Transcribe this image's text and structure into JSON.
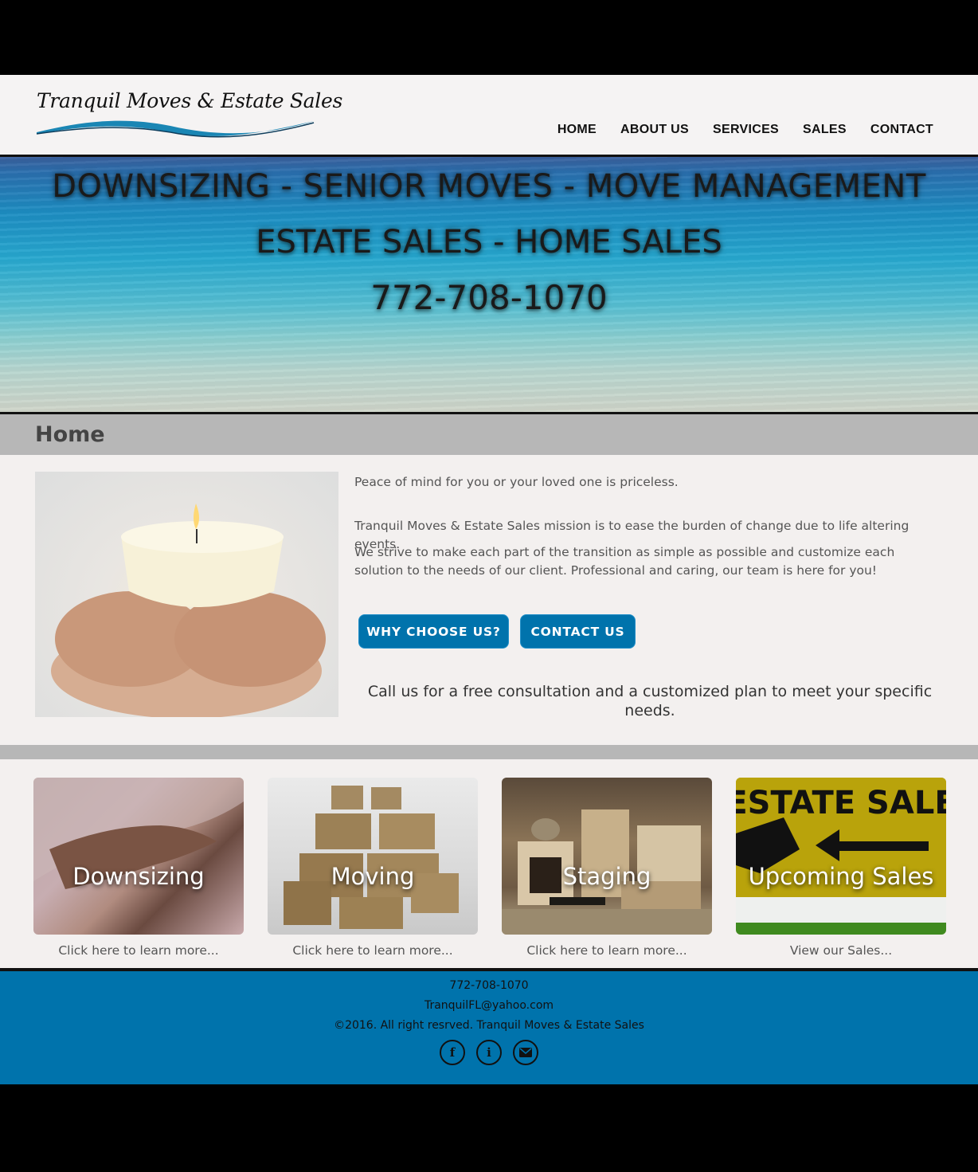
{
  "brand": {
    "name": "Tranquil Moves & Estate Sales"
  },
  "nav": {
    "items": [
      "HOME",
      "ABOUT US",
      "SERVICES",
      "SALES",
      "CONTACT"
    ]
  },
  "hero": {
    "line1": "DOWNSIZING - SENIOR MOVES - MOVE MANAGEMENT",
    "line2": "ESTATE SALES - HOME SALES",
    "phone": "772-708-1070"
  },
  "page_title": "Home",
  "intro": {
    "p1": "Peace of mind for you or your loved one is priceless.",
    "p2": "Tranquil Moves & Estate Sales mission is to ease the burden of change due to life altering events.",
    "p3": "We strive to make each part of the transition as simple as possible and customize each solution to the needs of our client. Professional and caring, our team is here for you!",
    "buttons": {
      "why": "WHY CHOOSE US?",
      "contact": "CONTACT US"
    },
    "cta": "Call us for a free consultation and a customized plan to meet your specific needs."
  },
  "tiles": [
    {
      "label": "Downsizing",
      "caption": "Click here to learn more..."
    },
    {
      "label": "Moving",
      "caption": "Click here to learn more..."
    },
    {
      "label": "Staging",
      "caption": "Click here to learn more..."
    },
    {
      "label": "Upcoming Sales",
      "caption": "View our Sales...",
      "sign_text": "ESTATE SALE"
    }
  ],
  "footer": {
    "phone": "772-708-1070",
    "email": "TranquilFL@yahoo.com",
    "copyright": "©2016. All right resrved. Tranquil Moves & Estate Sales",
    "icons": [
      "facebook-icon",
      "info-icon",
      "email-icon"
    ]
  },
  "colors": {
    "accent": "#0073ac",
    "title_bar": "#b7b7b7"
  }
}
